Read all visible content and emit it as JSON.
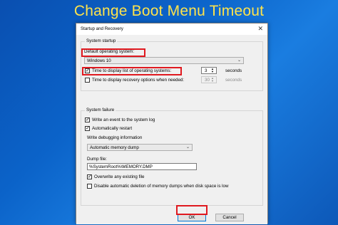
{
  "banner": {
    "title": "Change Boot Menu Timeout"
  },
  "dialog": {
    "title": "Startup and Recovery",
    "close_glyph": "✕",
    "system_startup": {
      "group_label": "System startup",
      "default_os_label": "Default operating system:",
      "default_os_value": "Windows 10",
      "time_to_display_label": "Time to display list of operating systems:",
      "time_to_display_checked": true,
      "time_to_display_value": "3",
      "time_to_display_units": "seconds",
      "recovery_label": "Time to display recovery options when needed:",
      "recovery_checked": false,
      "recovery_value": "30",
      "recovery_units": "seconds"
    },
    "system_failure": {
      "group_label": "System failure",
      "write_event_label": "Write an event to the system log",
      "write_event_checked": true,
      "auto_restart_label": "Automatically restart",
      "auto_restart_checked": true,
      "debug_info": {
        "group_label": "Write debugging information",
        "dump_type_value": "Automatic memory dump",
        "dump_file_label": "Dump file:",
        "dump_file_value": "%SystemRoot%\\MEMORY.DMP",
        "overwrite_label": "Overwrite any existing file",
        "overwrite_checked": true,
        "disable_auto_delete_label": "Disable automatic deletion of memory dumps when disk space is low",
        "disable_auto_delete_checked": false
      }
    },
    "buttons": {
      "ok": "OK",
      "cancel": "Cancel"
    },
    "colors": {
      "highlight": "#e0191f",
      "banner_text": "#ffe34a",
      "desktop": "#0b63c9"
    }
  }
}
